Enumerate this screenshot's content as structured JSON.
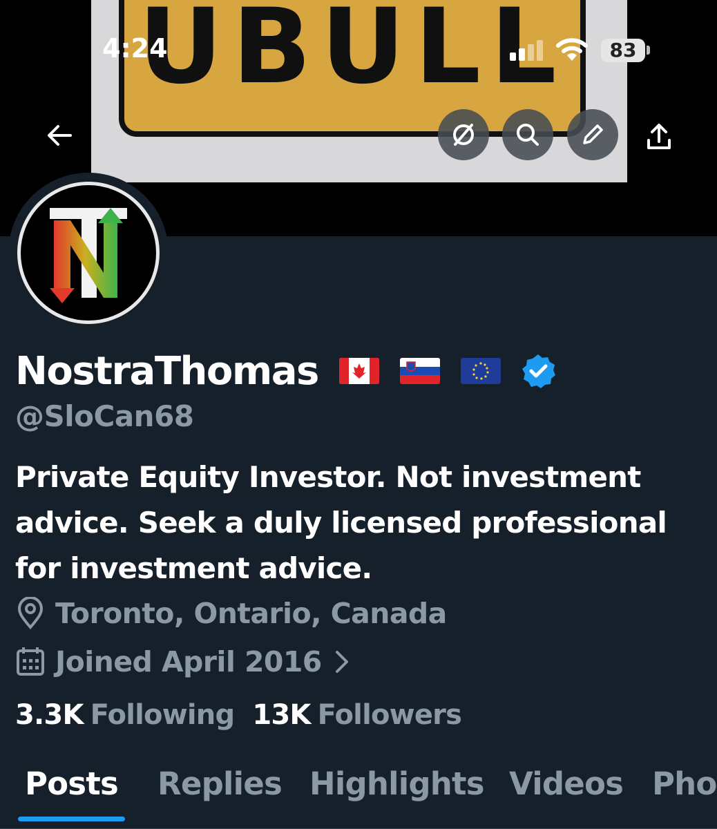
{
  "status_bar": {
    "time": "4:24",
    "battery": "83"
  },
  "banner": {
    "plate_text": "UBULL",
    "plate_color": "#d8a640"
  },
  "header": {
    "icons": [
      "back-arrow-icon",
      "refresh-icon",
      "search-icon",
      "edit-pencil-icon",
      "share-icon"
    ]
  },
  "profile": {
    "display_name": "NostraThomas",
    "flags": [
      "canada-flag-icon",
      "slovenia-flag-icon",
      "eu-flag-icon"
    ],
    "verified": true,
    "handle": "@SloCan68",
    "bio": "Private Equity Investor. Not investment advice. Seek a duly licensed professional for investment advice.",
    "location": "Toronto, Ontario, Canada",
    "joined": "Joined April 2016"
  },
  "stats": {
    "following_count": "3.3K",
    "following_label": "Following",
    "followers_count": "13K",
    "followers_label": "Followers"
  },
  "tabs": [
    {
      "label": "Posts",
      "active": true
    },
    {
      "label": "Replies",
      "active": false
    },
    {
      "label": "Highlights",
      "active": false
    },
    {
      "label": "Videos",
      "active": false
    },
    {
      "label": "Pho",
      "active": false
    }
  ],
  "colors": {
    "background": "#15202b",
    "accent": "#1d9bf0",
    "muted_text": "#8b98a5"
  }
}
